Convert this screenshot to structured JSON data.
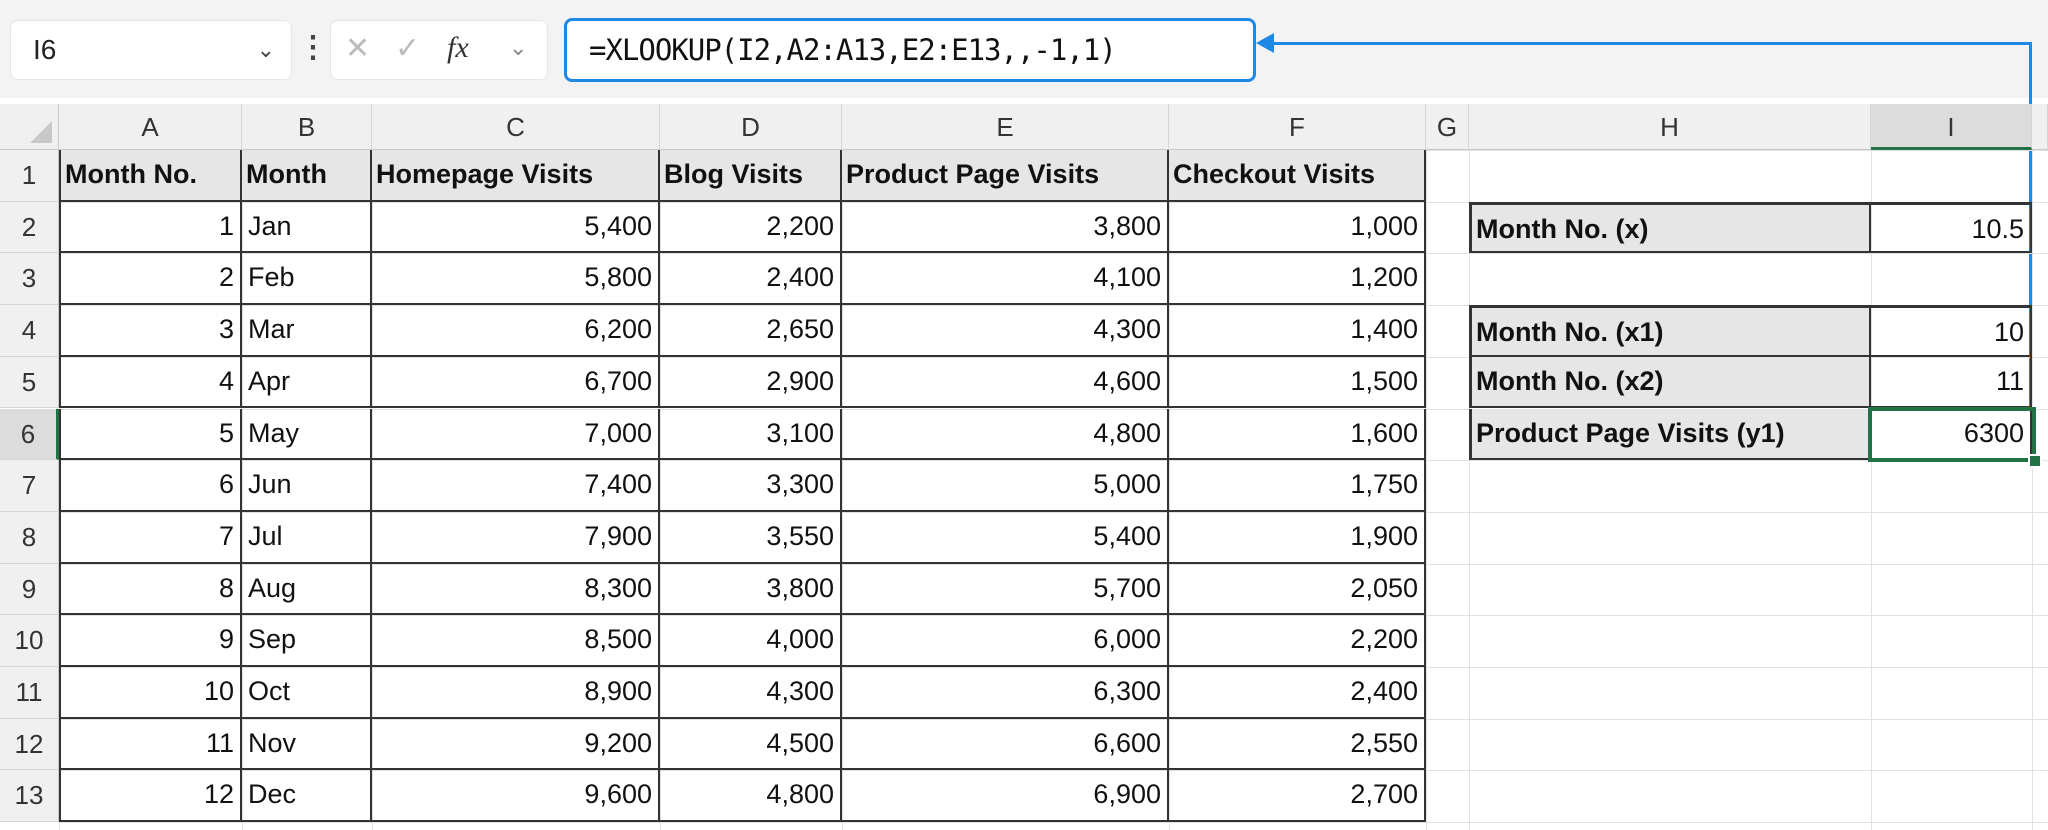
{
  "formula_bar": {
    "name_box": "I6",
    "cancel_icon": "✕",
    "enter_icon": "✓",
    "fx_label": "fx",
    "formula": "=XLOOKUP(I2,A2:A13,E2:E13,,-1,1)"
  },
  "columns": [
    "A",
    "B",
    "C",
    "D",
    "E",
    "F",
    "G",
    "H",
    "I"
  ],
  "rows": [
    "1",
    "2",
    "3",
    "4",
    "5",
    "6",
    "7",
    "8",
    "9",
    "10",
    "11",
    "12",
    "13"
  ],
  "table": {
    "headers": [
      "Month No.",
      "Month",
      "Homepage Visits",
      "Blog Visits",
      "Product Page Visits",
      "Checkout Visits"
    ],
    "rows": [
      [
        "1",
        "Jan",
        "5,400",
        "2,200",
        "3,800",
        "1,000"
      ],
      [
        "2",
        "Feb",
        "5,800",
        "2,400",
        "4,100",
        "1,200"
      ],
      [
        "3",
        "Mar",
        "6,200",
        "2,650",
        "4,300",
        "1,400"
      ],
      [
        "4",
        "Apr",
        "6,700",
        "2,900",
        "4,600",
        "1,500"
      ],
      [
        "5",
        "May",
        "7,000",
        "3,100",
        "4,800",
        "1,600"
      ],
      [
        "6",
        "Jun",
        "7,400",
        "3,300",
        "5,000",
        "1,750"
      ],
      [
        "7",
        "Jul",
        "7,900",
        "3,550",
        "5,400",
        "1,900"
      ],
      [
        "8",
        "Aug",
        "8,300",
        "3,800",
        "5,700",
        "2,050"
      ],
      [
        "9",
        "Sep",
        "8,500",
        "4,000",
        "6,000",
        "2,200"
      ],
      [
        "10",
        "Oct",
        "8,900",
        "4,300",
        "6,300",
        "2,400"
      ],
      [
        "11",
        "Nov",
        "9,200",
        "4,500",
        "6,600",
        "2,550"
      ],
      [
        "12",
        "Dec",
        "9,600",
        "4,800",
        "6,900",
        "2,700"
      ]
    ]
  },
  "side": {
    "x_label": "Month No. (x)",
    "x_value": "10.5",
    "x1_label": "Month No. (x1)",
    "x1_value": "10",
    "x2_label": "Month No. (x2)",
    "x2_value": "11",
    "y1_label": "Product Page Visits (y1)",
    "y1_value": "6300"
  },
  "colors": {
    "accent": "#1e88e5",
    "selection": "#217346"
  }
}
